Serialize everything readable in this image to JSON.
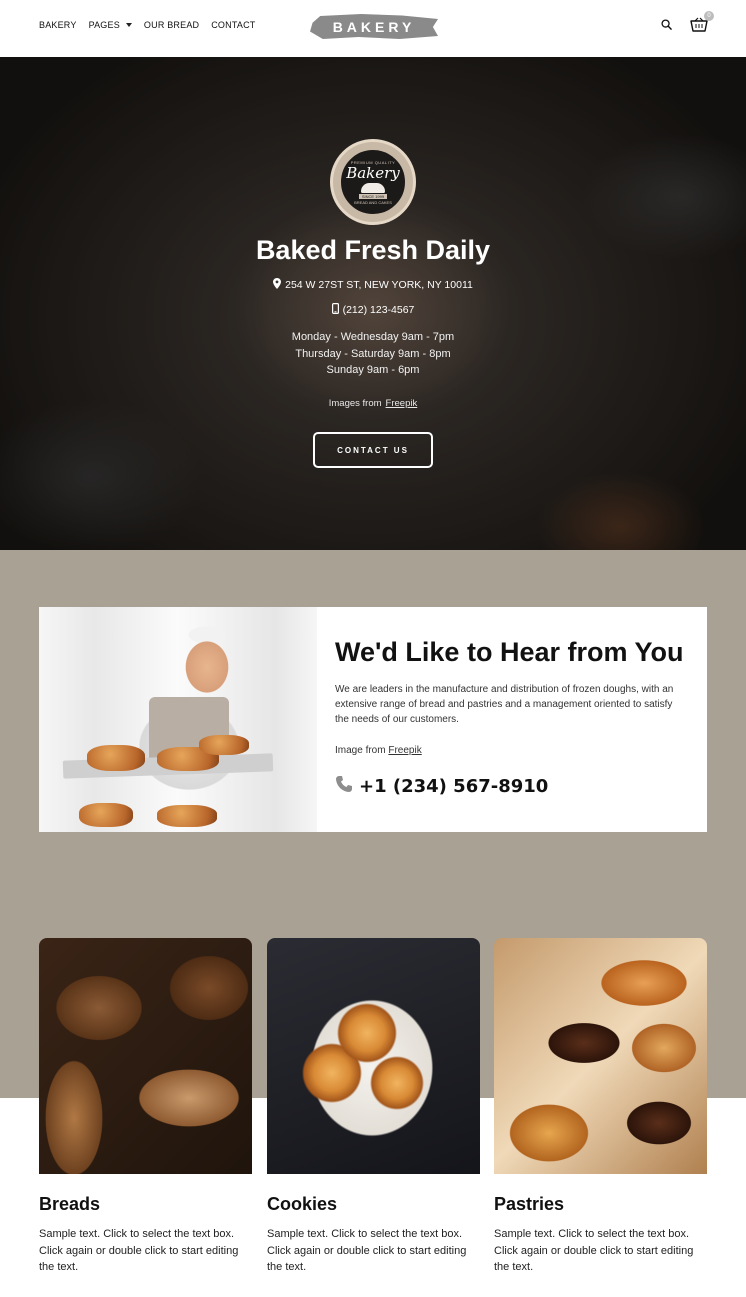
{
  "header": {
    "nav": [
      {
        "label": "BAKERY"
      },
      {
        "label": "PAGES"
      },
      {
        "label": "OUR BREAD"
      },
      {
        "label": "CONTACT"
      }
    ],
    "logo": "BAKERY",
    "cart_count": "0"
  },
  "hero": {
    "badge": {
      "top": "PREMIUM QUALITY",
      "name": "Bakery",
      "since": "SINCE 1999",
      "bottom": "BREAD AND CAKES"
    },
    "title": "Baked Fresh Daily",
    "address": "254 W 27ST ST, NEW YORK, NY 10011",
    "phone": "(212) 123-4567",
    "hours": [
      "Monday - Wednesday 9am - 7pm",
      "Thursday - Saturday 9am - 8pm",
      "Sunday 9am - 6pm"
    ],
    "credit_prefix": "Images from",
    "credit_link": "Freepik",
    "button": "CONTACT US"
  },
  "about": {
    "title": "We'd Like to Hear from You",
    "text": "We are leaders in the manufacture and distribution of frozen doughs, with an extensive range of bread and pastries and a management oriented to satisfy the needs of our customers.",
    "credit_prefix": "Image from",
    "credit_link": "Freepik",
    "phone": "+1 (234) 567-8910"
  },
  "products": [
    {
      "title": "Breads",
      "text": "Sample text. Click to select the text box. Click again or double click to start editing the text."
    },
    {
      "title": "Cookies",
      "text": "Sample text. Click to select the text box. Click again or double click to start editing the text."
    },
    {
      "title": "Pastries",
      "text": "Sample text. Click to select the text box. Click again or double click to start editing the text."
    }
  ],
  "icons": {
    "search": "search-icon",
    "cart": "cart-icon",
    "location": "map-pin-icon",
    "mobile": "mobile-phone-icon",
    "phone": "phone-icon",
    "dropdown": "chevron-down-icon"
  },
  "colors": {
    "section_bg": "#aaa195",
    "text": "#111111",
    "white": "#ffffff"
  }
}
